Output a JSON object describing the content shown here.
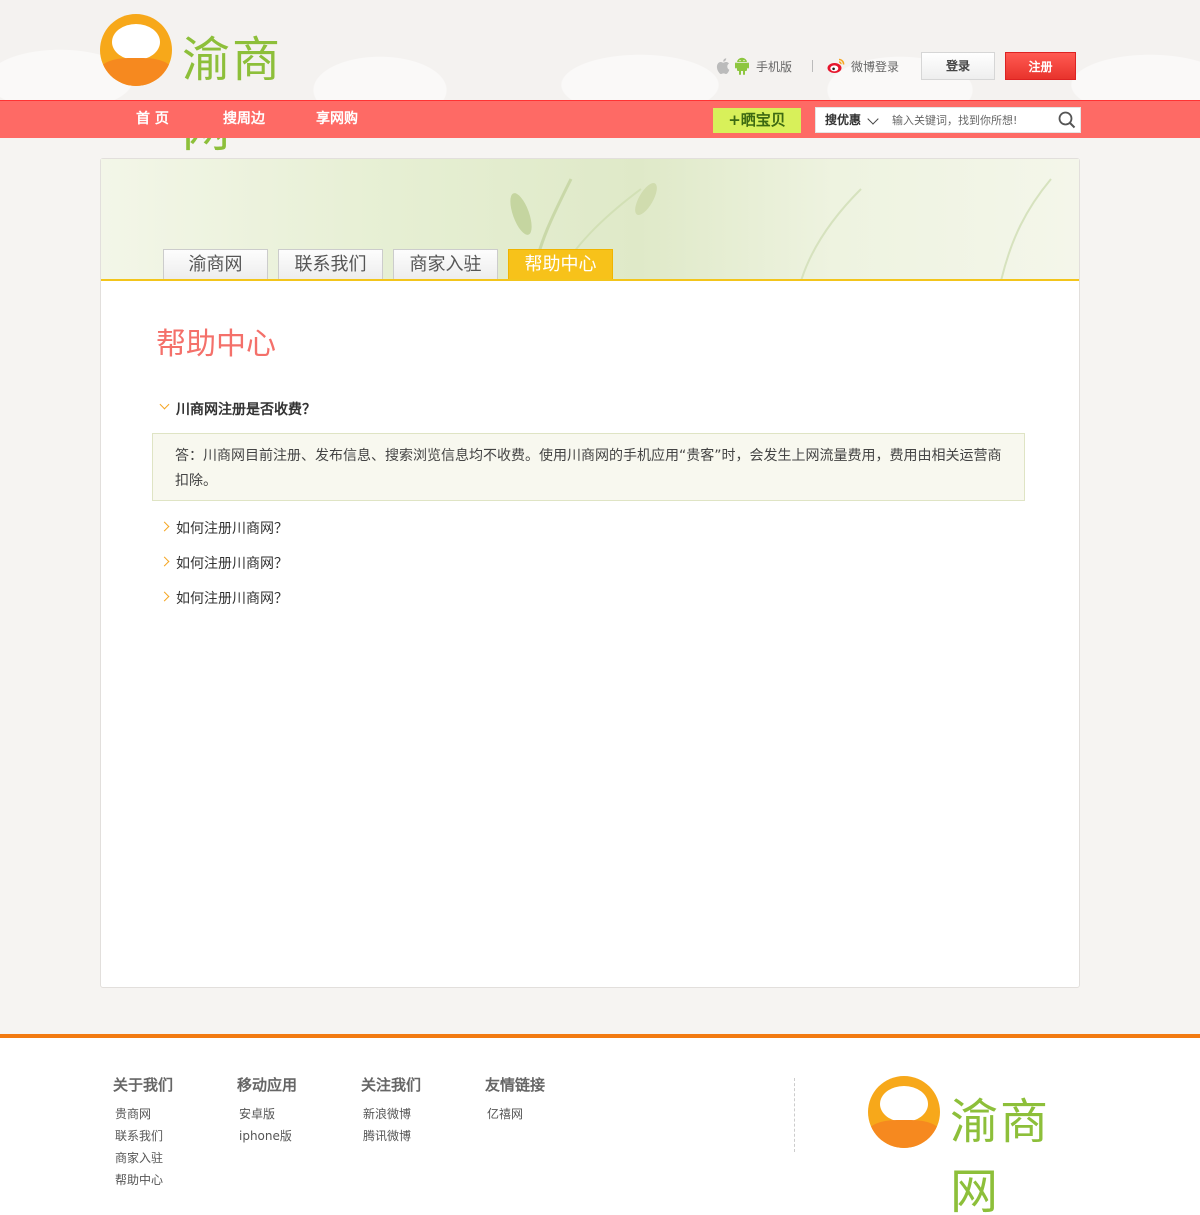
{
  "brand": {
    "name": "渝商网"
  },
  "header": {
    "mobile_label": "手机版",
    "weibo_login_label": "微博登录",
    "login_label": "登录",
    "register_label": "注册"
  },
  "nav": {
    "items": [
      {
        "label": "首 页"
      },
      {
        "label": "搜周边"
      },
      {
        "label": "享网购"
      }
    ],
    "show_button_label": "+晒宝贝",
    "search": {
      "type_label": "搜优惠",
      "placeholder": "输入关键词，找到你所想!"
    }
  },
  "tabs": [
    {
      "label": "渝商网",
      "active": false
    },
    {
      "label": "联系我们",
      "active": false
    },
    {
      "label": "商家入驻",
      "active": false
    },
    {
      "label": "帮助中心",
      "active": true
    }
  ],
  "page_title": "帮助中心",
  "faq": [
    {
      "question": "川商网注册是否收费？",
      "open": true,
      "answer": "答：川商网目前注册、发布信息、搜索浏览信息均不收费。使用川商网的手机应用“贵客”时，会发生上网流量费用，费用由相关运营商扣除。"
    },
    {
      "question": "如何注册川商网？",
      "open": false
    },
    {
      "question": "如何注册川商网？",
      "open": false
    },
    {
      "question": "如何注册川商网？",
      "open": false
    }
  ],
  "footer": {
    "columns": [
      {
        "title": "关于我们",
        "links": [
          "贵商网",
          "联系我们",
          "商家入驻",
          "帮助中心"
        ]
      },
      {
        "title": "移动应用",
        "links": [
          "安卓版",
          "iphone版"
        ]
      },
      {
        "title": "关注我们",
        "links": [
          "新浪微博",
          "腾讯微博"
        ]
      },
      {
        "title": "友情链接",
        "links": [
          "亿禧网"
        ]
      }
    ]
  },
  "colors": {
    "nav_bg": "#fe6a65",
    "accent_yellow": "#f7c21a",
    "register_red": "#e8332c",
    "title_pink": "#f4706a",
    "footer_orange": "#f27a12",
    "logo_green": "#8dbf3a"
  }
}
